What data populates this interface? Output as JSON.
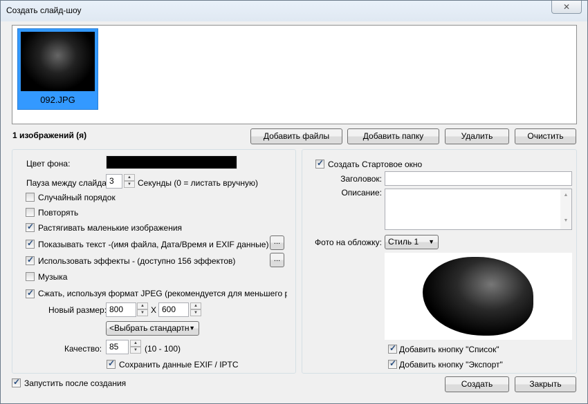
{
  "window": {
    "title": "Создать слайд-шоу",
    "close_icon": "close-icon"
  },
  "thumbnails": [
    {
      "filename": "092.JPG",
      "selected": true
    }
  ],
  "image_count": "1 изображений (я)",
  "toolbar": {
    "add_files": "Добавить файлы",
    "add_folder": "Добавить папку",
    "delete": "Удалить",
    "clear": "Очистить"
  },
  "left": {
    "bg_color_label": "Цвет фона:",
    "bg_color": "#000000",
    "pause_label": "Пауза между слайдам",
    "pause_value": "3",
    "pause_hint": "Секунды (0 = листать вручную)",
    "options": [
      {
        "label": "Случайный порядок",
        "checked": false
      },
      {
        "label": "Повторять",
        "checked": false
      },
      {
        "label": "Растягивать маленькие изображения",
        "checked": true
      },
      {
        "label": "Показывать текст -(имя файла, Дата/Время и EXIF данные)",
        "checked": true
      },
      {
        "label": "Использовать эффекты - (доступно 156 эффектов)",
        "checked": true
      },
      {
        "label": "Музыка",
        "checked": false
      },
      {
        "label": "Сжать, используя формат JPEG (рекомендуется для меньшего размер",
        "checked": true
      }
    ],
    "more_button": "...",
    "new_size_label": "Новый размер:",
    "width": "800",
    "x_label": "X",
    "height": "600",
    "preset_select": "<Выбрать стандартн",
    "quality_label": "Качество:",
    "quality": "85",
    "quality_range": "(10 - 100)",
    "keep_exif": {
      "label": "Сохранить данные EXIF / IPTC",
      "checked": true
    }
  },
  "right": {
    "create_start": {
      "label": "Создать Стартовое окно",
      "checked": true
    },
    "title_label": "Заголовок:",
    "title_value": "",
    "desc_label": "Описание:",
    "desc_value": "",
    "cover_label": "Фото на обложку:",
    "cover_style": "Стиль 1",
    "add_list": {
      "label": "Добавить кнопку \"Список\"",
      "checked": true
    },
    "add_export": {
      "label": "Добавить кнопку \"Экспорт\"",
      "checked": true
    }
  },
  "footer": {
    "run_after": {
      "label": "Запустить после создания",
      "checked": true
    },
    "create": "Создать",
    "close": "Закрыть"
  }
}
